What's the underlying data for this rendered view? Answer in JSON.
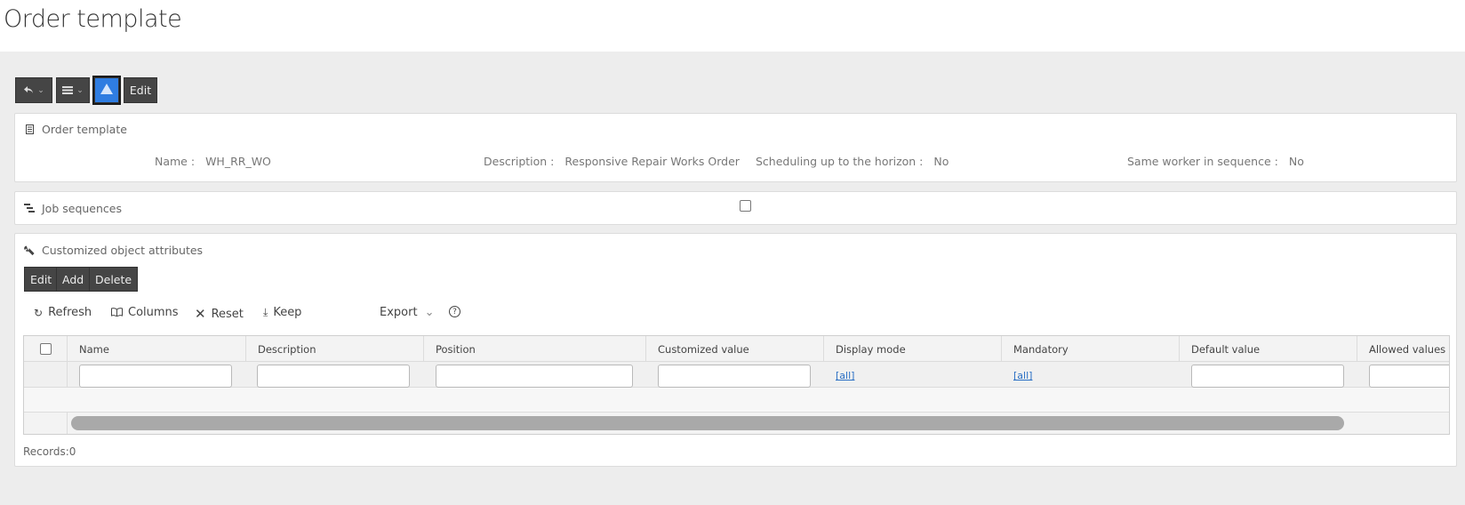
{
  "page": {
    "title": "Order template"
  },
  "toolbar": {
    "edit_label": "Edit"
  },
  "header_panel": {
    "title": "Order template",
    "fields": [
      {
        "label": "Name :",
        "value": "WH_RR_WO"
      },
      {
        "label": "Description :",
        "value": "Responsive Repair Works Order"
      },
      {
        "label": "Scheduling up to the horizon :",
        "value": "No"
      },
      {
        "label": "Same worker in sequence :",
        "value": "No"
      }
    ]
  },
  "job_panel": {
    "title": "Job sequences",
    "checked": false
  },
  "attr_panel": {
    "title": "Customized object attributes",
    "buttons": {
      "edit": "Edit",
      "add": "Add",
      "delete": "Delete"
    },
    "tools": {
      "refresh": "Refresh",
      "columns": "Columns",
      "reset": "Reset",
      "keep": "Keep",
      "export": "Export"
    },
    "columns": [
      "Name",
      "Description",
      "Position",
      "Customized value",
      "Display mode",
      "Mandatory",
      "Default value",
      "Allowed values"
    ],
    "filter_all": "[all]",
    "records": "Records:0"
  },
  "colors": {
    "button_bg": "#454545",
    "active_accent": "#2f7de1",
    "link": "#2a6fc4"
  }
}
